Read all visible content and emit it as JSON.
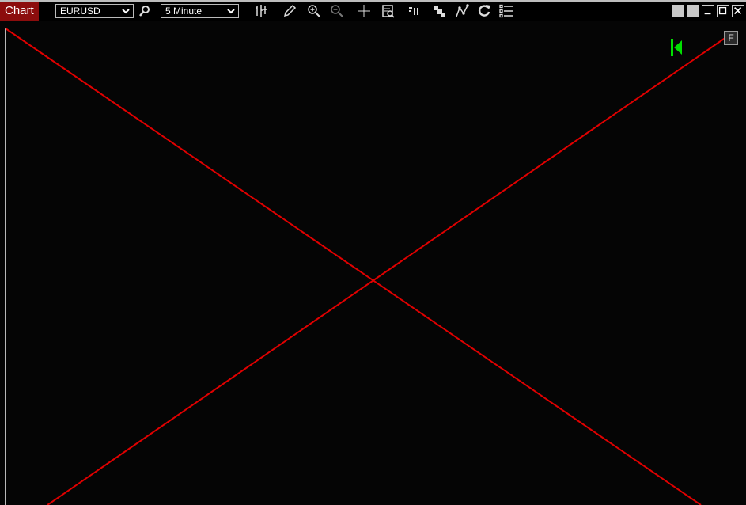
{
  "window": {
    "title": "Chart"
  },
  "toolbar": {
    "symbol": "EURUSD",
    "timeframe": "5 Minute",
    "icons": [
      "search-icon",
      "bar-style-icon",
      "pencil-icon",
      "zoom-in-icon",
      "zoom-out-icon",
      "crosshair-icon",
      "data-box-icon",
      "indicator-icon",
      "compare-icon",
      "studies-icon",
      "refresh-icon",
      "list-icon"
    ]
  },
  "window_controls": {
    "icons": [
      "layout-icon-1",
      "layout-icon-2",
      "minimize-icon",
      "maximize-icon",
      "close-icon"
    ]
  },
  "chart": {
    "f_button_label": "F",
    "error_color": "#e00000",
    "marker_color": "#00e000",
    "background": "#050505"
  }
}
